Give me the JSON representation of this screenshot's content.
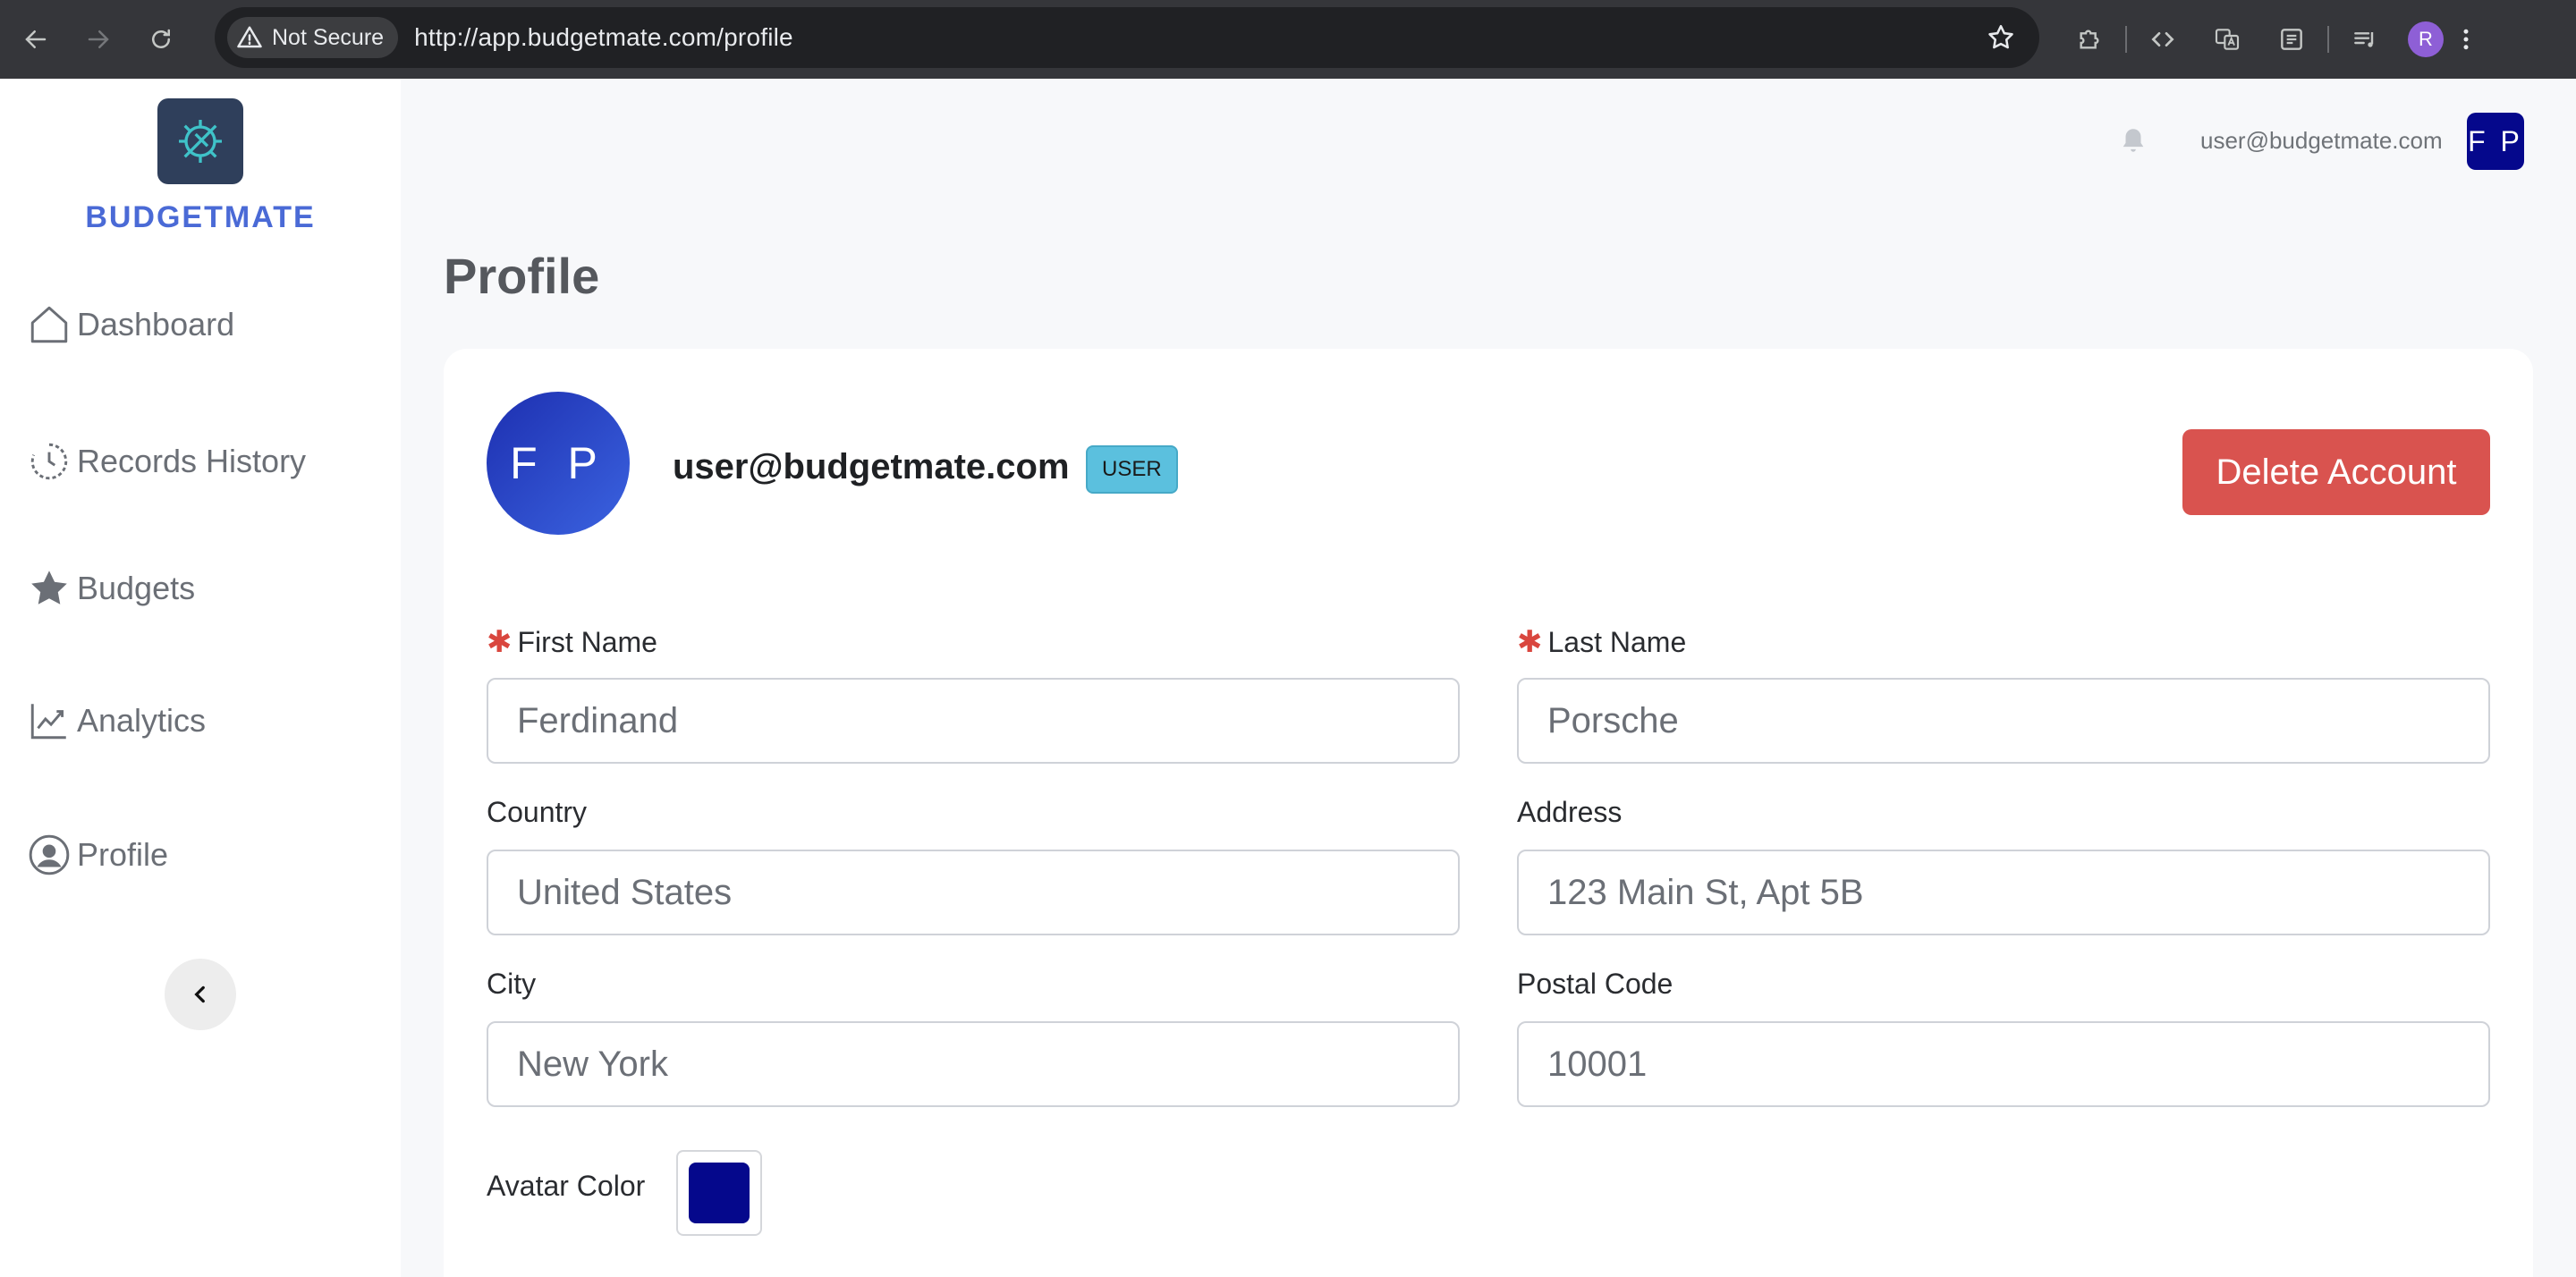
{
  "browser": {
    "security_label": "Not Secure",
    "url": "http://app.budgetmate.com/profile",
    "profile_initial": "R"
  },
  "sidebar": {
    "brand": "BUDGETMATE",
    "items": [
      {
        "label": "Dashboard",
        "icon": "home-icon"
      },
      {
        "label": "Records History",
        "icon": "history-icon"
      },
      {
        "label": "Budgets",
        "icon": "star-icon"
      },
      {
        "label": "Analytics",
        "icon": "chart-line-icon"
      },
      {
        "label": "Profile",
        "icon": "user-circle-icon"
      }
    ]
  },
  "header": {
    "email": "user@budgetmate.com",
    "avatar_initials": "F P",
    "avatar_color": "#05088c"
  },
  "page": {
    "title": "Profile"
  },
  "profile": {
    "avatar_initials": "F P",
    "email": "user@budgetmate.com",
    "role": "USER",
    "delete_label": "Delete Account",
    "fields": {
      "first_name": {
        "label": "First Name",
        "value": "Ferdinand",
        "required": true
      },
      "last_name": {
        "label": "Last Name",
        "value": "Porsche",
        "required": true
      },
      "country": {
        "label": "Country",
        "value": "United States"
      },
      "address": {
        "label": "Address",
        "value": "123 Main St, Apt 5B"
      },
      "city": {
        "label": "City",
        "value": "New York"
      },
      "postal_code": {
        "label": "Postal Code",
        "value": "10001"
      }
    },
    "avatar_color": {
      "label": "Avatar Color",
      "value": "#05088c"
    }
  },
  "colors": {
    "brand": "#4a6ad6",
    "danger": "#d9534f",
    "badge": "#5bc0de"
  }
}
